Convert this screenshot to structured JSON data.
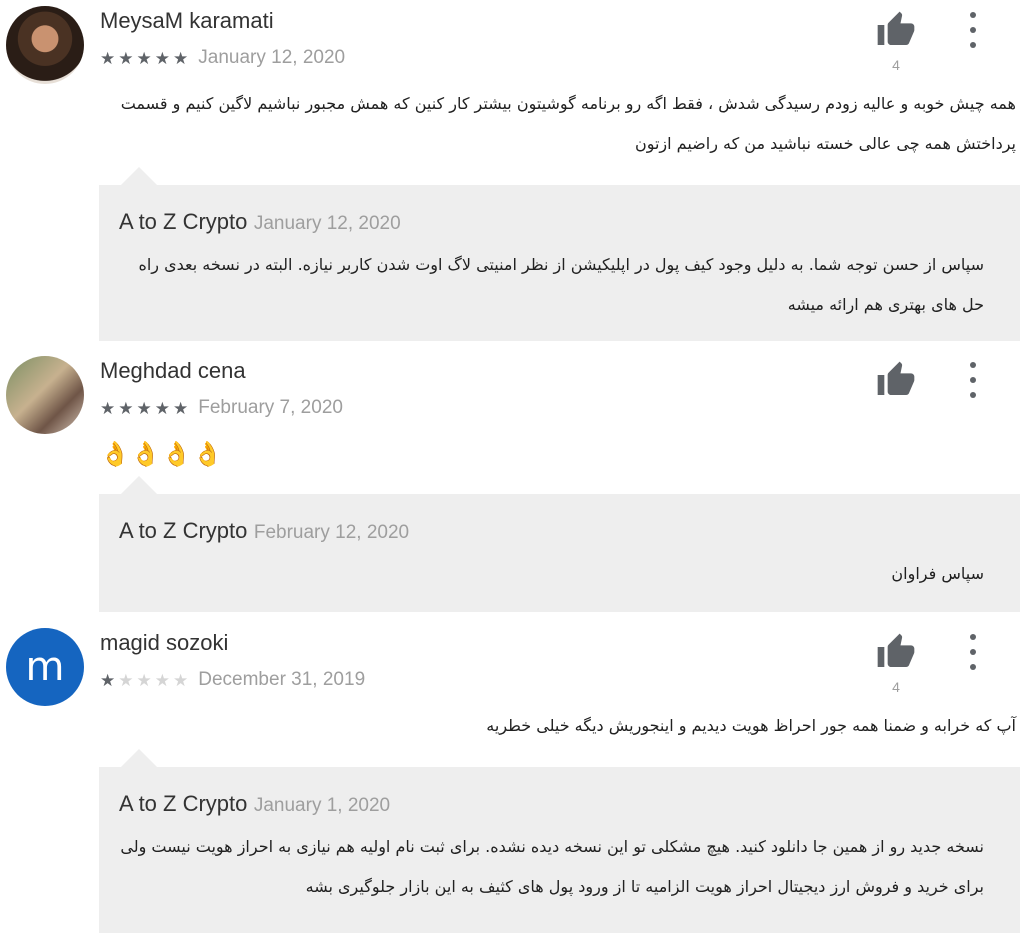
{
  "reviews": [
    {
      "author": "MeysaM karamati",
      "avatar": "profile-photo",
      "rating": 5,
      "date": "January 12, 2020",
      "helpful_count": "4",
      "text": "همه چیش خوبه و عالیه زودم رسیدگی شدش ، فقط اگه رو برنامه گوشیتون بیشتر کار کنین که همش مجبور نباشیم لاگین کنیم و قسمت پرداختش همه چی عالی خسته نباشید من که راضیم ازتون",
      "reply": {
        "author": "A to Z Crypto",
        "date": "January 12, 2020",
        "text": "سپاس از حسن توجه شما. به دلیل وجود کیف پول در اپلیکیشن از نظر امنیتی لاگ اوت شدن کاربر نیازه. البته در نسخه بعدی راه حل های بهتری هم ارائه میشه"
      }
    },
    {
      "author": "Meghdad cena",
      "avatar": "profile-photo",
      "rating": 5,
      "date": "February 7, 2020",
      "helpful_count": "",
      "text": "👌👌👌👌",
      "reply": {
        "author": "A to Z Crypto",
        "date": "February 12, 2020",
        "text": "سپاس فراوان"
      }
    },
    {
      "author": "magid sozoki",
      "avatar": "m",
      "rating": 1,
      "date": "December 31, 2019",
      "helpful_count": "4",
      "text": "آپ که خرابه و ضمنا همه جور احراظ هویت دیدیم و اینجوریش دیگه خیلی خطریه",
      "reply": {
        "author": "A to Z Crypto",
        "date": "January 1, 2020",
        "text": "نسخه جدید رو از همین جا دانلود کنید. هیچ مشکلی تو این نسخه دیده نشده. برای ثبت نام اولیه هم نیازی به احراز هویت نیست ولی برای خرید و فروش ارز دیجیتال احراز هویت الزامیه تا از ورود پول های کثیف به این بازار جلوگیری بشه"
      }
    }
  ],
  "icons": {
    "star_full": "★",
    "star_empty": "★",
    "thumbs_up": "thumbs-up-icon",
    "more": "more-vert-icon"
  }
}
